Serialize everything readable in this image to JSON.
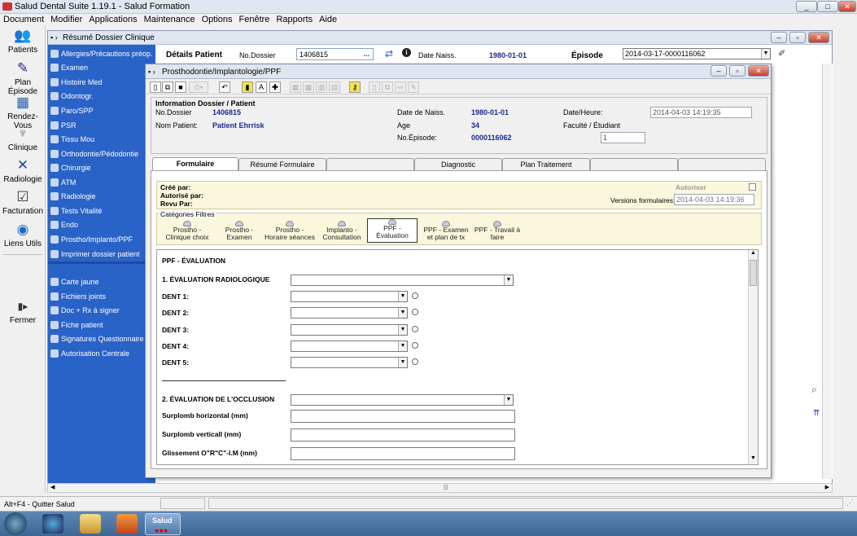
{
  "app": {
    "title": "Salud Dental Suite 1.19.1 - Salud Formation"
  },
  "menu": [
    "Document",
    "Modifier",
    "Applications",
    "Maintenance",
    "Options",
    "Fenêtre",
    "Rapports",
    "Aide"
  ],
  "lefttool": [
    {
      "label": "Patients",
      "icon": "patients-icon"
    },
    {
      "label": "Plan Épisode",
      "icon": "plan-icon"
    },
    {
      "label": "Rendez-Vous",
      "icon": "calendar-icon"
    },
    {
      "label": "Clinique",
      "icon": "tooth-icon"
    },
    {
      "label": "Radiologie",
      "icon": "xray-icon"
    },
    {
      "label": "Facturation",
      "icon": "billing-icon"
    },
    {
      "label": "Liens Utils",
      "icon": "globe-icon"
    },
    {
      "label": "Fermer",
      "icon": "door-icon"
    }
  ],
  "outer": {
    "title": "Résumé Dossier Clinique"
  },
  "nav": [
    "Allergies/Précautions préop.",
    "Examen",
    "Histoire Med",
    "Odontogr.",
    "Paro/SPP",
    "PSR",
    "Tissu Mou",
    "Orthodontie/Pédodontie",
    "Chirurgie",
    "ATM",
    "Radiologie",
    "Tests Vitalité",
    "Endo",
    "Prostho/Implanto/PPF",
    "Imprimer dossier patient"
  ],
  "nav2": [
    "Carte jaune",
    "Fichiers joints",
    "Doc + Rx à signer",
    "Fiche patient",
    "Signatures Questionnaire",
    "Autorisation Centrale"
  ],
  "details": {
    "heading": "Détails Patient",
    "dossier_label": "No.Dossier",
    "dossier": "1406815",
    "dots": "...",
    "naiss_label": "Date Naiss.",
    "naiss": "1980-01-01",
    "episode_label": "Épisode",
    "episode": "2014-03-17-0000116062"
  },
  "inner": {
    "title": "Prosthodontie/Implantologie/PPF"
  },
  "info": {
    "heading": "Information Dossier / Patient",
    "dossier_label": "No.Dossier",
    "dossier": "1406815",
    "nom_label": "Nom Patient:",
    "nom": "Patient Ehrrisk",
    "naiss_label": "Date de Naiss.",
    "naiss": "1980-01-01",
    "age_label": "Age",
    "age": "34",
    "episode_label": "No.Épisode:",
    "episode": "0000116062",
    "datetime_label": "Date/Heure:",
    "datetime": "2014-04-03 14:19:35",
    "faculte_label": "Faculté / Étudiant",
    "faculte": "1"
  },
  "tabs": [
    "Formulaire",
    "Résumé Formulaire",
    "",
    "Diagnostic",
    "Plan Traitement",
    "",
    ""
  ],
  "yellow": {
    "cree": "Créé par:",
    "autorise": "Autorisé par:",
    "revu": "Revu Par:",
    "autoriser": "Autoriser",
    "versions_label": "Versions formulaires:",
    "versions": "2014-04-03 14:19:36"
  },
  "categories": {
    "title": "Catégories Filtres",
    "items": [
      "Prostho - Clinique choix",
      "Prostho - Examen",
      "Prostho - Horaire séances",
      "Implanto - Consultation",
      "PPF - Évaluation",
      "PPF - Examen et plan de tx",
      "PPF - Travail à faire"
    ]
  },
  "form": {
    "title": "PPF - ÉVALUATION",
    "eval_radio": "1. ÉVALUATION RADIOLOGIQUE",
    "dents": [
      "DENT 1:",
      "DENT 2:",
      "DENT 3:",
      "DENT 4:",
      "DENT 5:"
    ],
    "occlusion": "2. ÉVALUATION DE L'OCCLUSION",
    "surplomb_h": "Surplomb horizontal (mm)",
    "surplomb_v": "Surplomb verticall (mm)",
    "glissement": "Glissement O\"R\"C\"-I.M (mm)"
  },
  "status": {
    "text": "Alt+F4 - Quitter Salud"
  },
  "taskbar": {
    "salud": "Salud"
  }
}
